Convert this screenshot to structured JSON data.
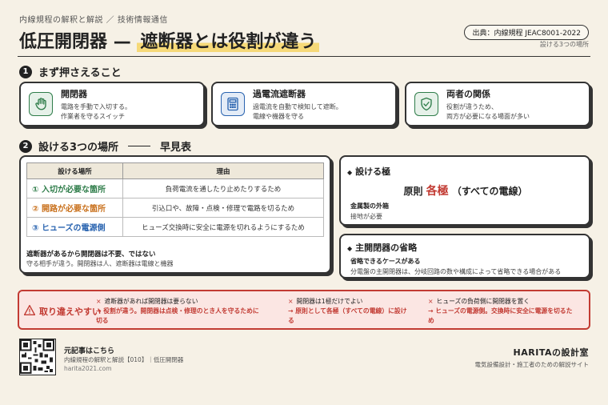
{
  "header": {
    "breadcrumb": "内線規程の解釈と解説 ／ 技術情報通信",
    "title_main": "低圧開閉器",
    "title_dash": "—",
    "title_highlight": "遮断器とは役割が違う",
    "source": "出典：内線規程 JEAC8001-2022",
    "subnote": "設ける3つの場所"
  },
  "section1": {
    "num": "1",
    "heading": "まず押さえること",
    "cards": [
      {
        "title": "開閉器",
        "desc1": "電路を手動で入切する。",
        "desc2": "作業者を守るスイッチ",
        "icon": "hand-icon",
        "color": "#2f7d4a"
      },
      {
        "title": "過電流遮断器",
        "desc1": "過電流を自動で検知して遮断。",
        "desc2": "電線や機器を守る",
        "icon": "calculator-icon",
        "color": "#2a64b0"
      },
      {
        "title": "両者の関係",
        "desc1": "役割が違うため、",
        "desc2": "両方が必要になる場面が多い",
        "icon": "shield-check-icon",
        "color": "#2f7d4a"
      }
    ]
  },
  "section2": {
    "num": "2",
    "heading": "設ける3つの場所",
    "heading_suffix": "早見表",
    "table": {
      "headers": [
        "設ける場所",
        "理由"
      ],
      "rows": [
        {
          "place": "① 入切が必要な箇所",
          "reason": "負荷電流を通したり止めたりするため",
          "color": "#2f7d4a"
        },
        {
          "place": "② 開路が必要な箇所",
          "reason": "引込口や、故障・点検・修理で電路を切るため",
          "color": "#c9711d"
        },
        {
          "place": "③ ヒューズの電源側",
          "reason": "ヒューズ交換時に安全に電源を切れるようにするため",
          "color": "#2a64b0"
        }
      ]
    },
    "note_bold": "遮断器があるから開閉器は不要、ではない",
    "note_small": "守る相手が違う。開閉器は人、遮断器は電線と機器"
  },
  "poles": {
    "heading": "設ける極",
    "principle_prefix": "原則",
    "principle_red": "各極",
    "principle_suffix": "（すべての電線）",
    "sub_bold": "金属製の外箱",
    "sub_small": "接地が必要"
  },
  "omission": {
    "heading": "主開閉器の省略",
    "sub_bold": "省略できるケースがある",
    "sub_small": "分電盤の主開閉器は、分岐回路の数や構成によって省略できる場合がある"
  },
  "warning": {
    "label": "取り違えやすい",
    "items": [
      {
        "wrong": "遮断器があれば開閉器は要らない",
        "right1": "→ 役割が違う。開閉器は点検・修理のとき人を守るために",
        "right2": "切る"
      },
      {
        "wrong": "開閉器は1極だけでよい",
        "right1": "→ 原則として各極（すべての電線）に設け",
        "right2": "る"
      },
      {
        "wrong": "ヒューズの負荷側に開閉器を置く",
        "right1": "→ ヒューズの電源側。交換時に安全に電源を切るた",
        "right2": "め"
      }
    ]
  },
  "footer": {
    "link_title": "元記事はこちら",
    "link_desc": "内線規程の解釈と解説【010】｜低圧開閉器",
    "url": "harita2021.com",
    "brand": "HARITAの設計室",
    "tagline": "電気設備設計・施工者のための解説サイト"
  }
}
